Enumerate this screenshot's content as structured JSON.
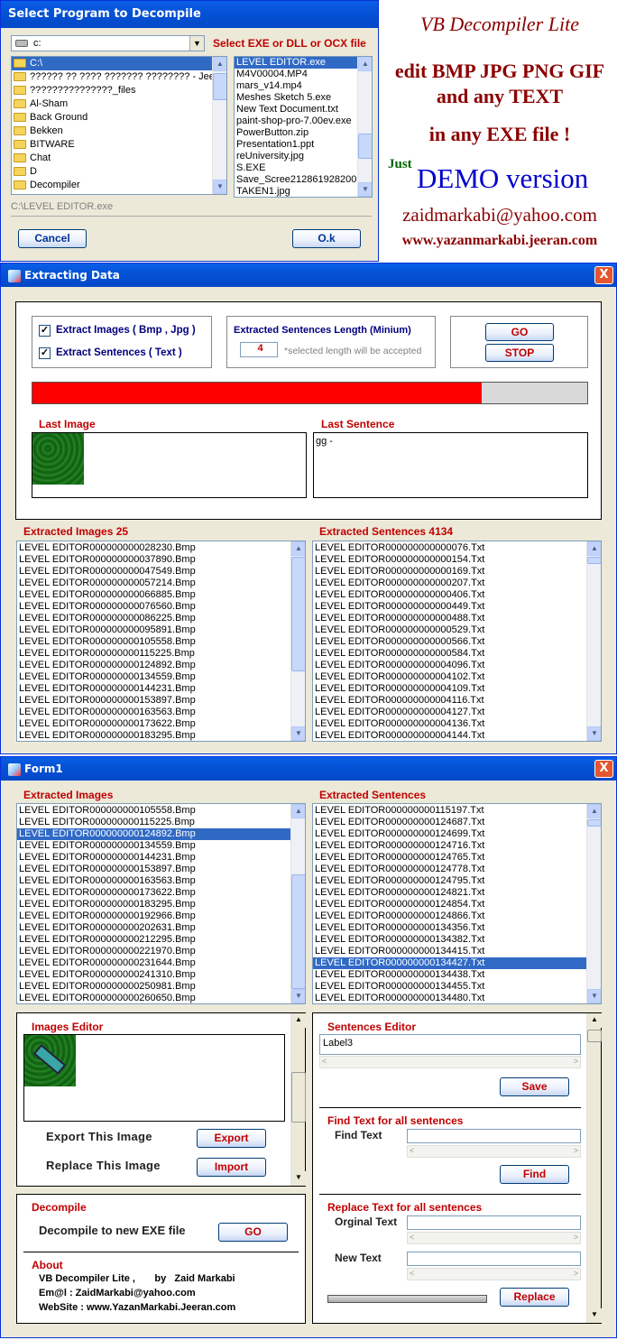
{
  "select_dialog": {
    "title": "Select Program to Decompile",
    "drive_value": "c:",
    "select_label": "Select EXE or DLL or OCX file",
    "folders": [
      "C:\\",
      "?????? ?? ???? ??????? ???????? - Jeer",
      "???????????????_files",
      "Al-Sham",
      "Back Ground",
      "Bekken",
      "BITWARE",
      "Chat",
      "D",
      "Decompiler"
    ],
    "files": [
      "LEVEL EDITOR.exe",
      "M4V00004.MP4",
      "mars_v14.mp4",
      "Meshes Sketch 5.exe",
      "New Text Document.txt",
      "paint-shop-pro-7.00ev.exe",
      "PowerButton.zip",
      "Presentation1.ppt",
      "reUniversity.jpg",
      "S.EXE",
      "Save_Scree212861928200",
      "TAKEN1.jpg"
    ],
    "path": "C:\\LEVEL EDITOR.exe",
    "cancel_label": "Cancel",
    "ok_label": "O.k"
  },
  "promo": {
    "title": "VB Decompiler Lite",
    "line1": "edit BMP JPG PNG GIF",
    "line2": "and any TEXT",
    "line3": "in any EXE file !",
    "just": "Just",
    "demo": "DEMO version",
    "email": "zaidmarkabi@yahoo.com",
    "website": "www.yazanmarkabi.jeeran.com"
  },
  "extract": {
    "title": "Extracting Data",
    "close": "X",
    "chk_images": "Extract Images ( Bmp , Jpg )",
    "chk_sentences": "Extract Sentences ( Text )",
    "length_label": "Extracted Sentences Length  (Minium)",
    "length_value": "4",
    "length_hint": "*selected length will be accepted",
    "go": "GO",
    "stop": "STOP",
    "progress": 0.81,
    "last_image_label": "Last Image",
    "last_sentence_label": "Last Sentence",
    "last_sentence_value": "gg -",
    "images_header": "Extracted Images 25",
    "sentences_header": "Extracted Sentences 4134",
    "images": [
      "LEVEL EDITOR000000000028230.Bmp",
      "LEVEL EDITOR000000000037890.Bmp",
      "LEVEL EDITOR000000000047549.Bmp",
      "LEVEL EDITOR000000000057214.Bmp",
      "LEVEL EDITOR000000000066885.Bmp",
      "LEVEL EDITOR000000000076560.Bmp",
      "LEVEL EDITOR000000000086225.Bmp",
      "LEVEL EDITOR000000000095891.Bmp",
      "LEVEL EDITOR000000000105558.Bmp",
      "LEVEL EDITOR000000000115225.Bmp",
      "LEVEL EDITOR000000000124892.Bmp",
      "LEVEL EDITOR000000000134559.Bmp",
      "LEVEL EDITOR000000000144231.Bmp",
      "LEVEL EDITOR000000000153897.Bmp",
      "LEVEL EDITOR000000000163563.Bmp",
      "LEVEL EDITOR000000000173622.Bmp",
      "LEVEL EDITOR000000000183295.Bmp"
    ],
    "sentences": [
      "LEVEL EDITOR000000000000076.Txt",
      "LEVEL EDITOR000000000000154.Txt",
      "LEVEL EDITOR000000000000169.Txt",
      "LEVEL EDITOR000000000000207.Txt",
      "LEVEL EDITOR000000000000406.Txt",
      "LEVEL EDITOR000000000000449.Txt",
      "LEVEL EDITOR000000000000488.Txt",
      "LEVEL EDITOR000000000000529.Txt",
      "LEVEL EDITOR000000000000566.Txt",
      "LEVEL EDITOR000000000000584.Txt",
      "LEVEL EDITOR000000000004096.Txt",
      "LEVEL EDITOR000000000004102.Txt",
      "LEVEL EDITOR000000000004109.Txt",
      "LEVEL EDITOR000000000004116.Txt",
      "LEVEL EDITOR000000000004127.Txt",
      "LEVEL EDITOR000000000004136.Txt",
      "LEVEL EDITOR000000000004144.Txt"
    ]
  },
  "form1": {
    "title": "Form1",
    "close": "X",
    "images_header": "Extracted Images",
    "sentences_header": "Extracted Sentences",
    "images": [
      "LEVEL EDITOR000000000105558.Bmp",
      "LEVEL EDITOR000000000115225.Bmp",
      "LEVEL EDITOR000000000124892.Bmp",
      "LEVEL EDITOR000000000134559.Bmp",
      "LEVEL EDITOR000000000144231.Bmp",
      "LEVEL EDITOR000000000153897.Bmp",
      "LEVEL EDITOR000000000163563.Bmp",
      "LEVEL EDITOR000000000173622.Bmp",
      "LEVEL EDITOR000000000183295.Bmp",
      "LEVEL EDITOR000000000192966.Bmp",
      "LEVEL EDITOR000000000202631.Bmp",
      "LEVEL EDITOR000000000212295.Bmp",
      "LEVEL EDITOR000000000221970.Bmp",
      "LEVEL EDITOR000000000231644.Bmp",
      "LEVEL EDITOR000000000241310.Bmp",
      "LEVEL EDITOR000000000250981.Bmp",
      "LEVEL EDITOR000000000260650.Bmp"
    ],
    "images_selected": 2,
    "sentences": [
      "LEVEL EDITOR000000000115197.Txt",
      "LEVEL EDITOR000000000124687.Txt",
      "LEVEL EDITOR000000000124699.Txt",
      "LEVEL EDITOR000000000124716.Txt",
      "LEVEL EDITOR000000000124765.Txt",
      "LEVEL EDITOR000000000124778.Txt",
      "LEVEL EDITOR000000000124795.Txt",
      "LEVEL EDITOR000000000124821.Txt",
      "LEVEL EDITOR000000000124854.Txt",
      "LEVEL EDITOR000000000124866.Txt",
      "LEVEL EDITOR000000000134356.Txt",
      "LEVEL EDITOR000000000134382.Txt",
      "LEVEL EDITOR000000000134415.Txt",
      "LEVEL EDITOR000000000134427.Txt",
      "LEVEL EDITOR000000000134438.Txt",
      "LEVEL EDITOR000000000134455.Txt",
      "LEVEL EDITOR000000000134480.Txt"
    ],
    "sentences_selected": 13,
    "images_editor_label": "Images Editor",
    "export_text": "Export This Image",
    "export_btn": "Export",
    "replace_text": "Replace This Image",
    "import_btn": "Import",
    "decompile_label": "Decompile",
    "decompile_text": "Decompile to new EXE file",
    "decompile_go": "GO",
    "about_label": "About",
    "about_line1": "VB Decompiler Lite ,       by   Zaid Markabi",
    "about_line2": "Em@l : ZaidMarkabi@yahoo.com",
    "about_line3": "WebSite : www.YazanMarkabi.Jeeran.com",
    "sentences_editor_label": "Sentences Editor",
    "sentence_value": "Label3",
    "save_btn": "Save",
    "find_section": "Find Text for all sentences",
    "find_label": "Find Text",
    "find_value": "",
    "find_btn": "Find",
    "replace_section": "Replace Text for all sentences",
    "orginal_label": "Orginal Text",
    "new_label": "New Text",
    "replace_btn": "Replace"
  }
}
